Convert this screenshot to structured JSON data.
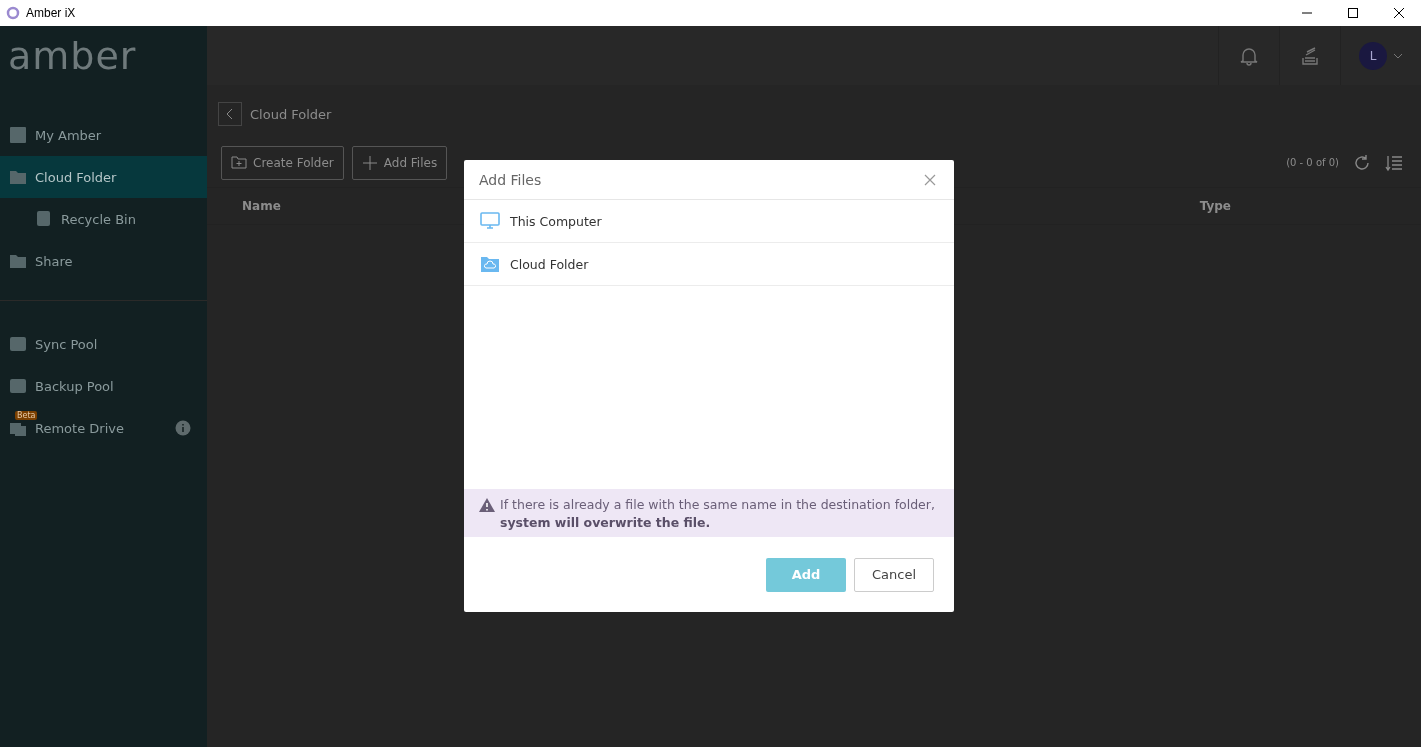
{
  "window": {
    "title": "Amber iX"
  },
  "sidebar": {
    "logo": "amber",
    "groups": [
      {
        "items": [
          {
            "label": "My Amber",
            "selected": false
          },
          {
            "label": "Cloud Folder",
            "selected": true,
            "children": [
              {
                "label": "Recycle Bin",
                "selected": false
              }
            ]
          },
          {
            "label": "Share",
            "selected": false
          }
        ]
      },
      {
        "items": [
          {
            "label": "Sync Pool",
            "selected": false
          },
          {
            "label": "Backup Pool",
            "selected": false
          },
          {
            "label": "Remote Drive",
            "selected": false,
            "badge": "Beta",
            "info": true
          }
        ]
      }
    ]
  },
  "header": {
    "avatar": "L"
  },
  "breadcrumb": {
    "current": "Cloud Folder"
  },
  "toolbar": {
    "buttons": [
      {
        "label": "Create Folder"
      },
      {
        "label": "Add Files"
      }
    ],
    "count": "(0 - 0 of 0)"
  },
  "table": {
    "columns": [
      "Name",
      "Type"
    ]
  },
  "dialog": {
    "title": "Add Files",
    "options": [
      {
        "label": "This Computer"
      },
      {
        "label": "Cloud Folder"
      }
    ],
    "notice": "If there is already a file with the same name in the destination folder, **system will overwrite the file.**",
    "buttons": [
      {
        "label": "Add",
        "kind": "primary",
        "disabled": true
      },
      {
        "label": "Cancel",
        "kind": "secondary",
        "disabled": false
      }
    ]
  }
}
